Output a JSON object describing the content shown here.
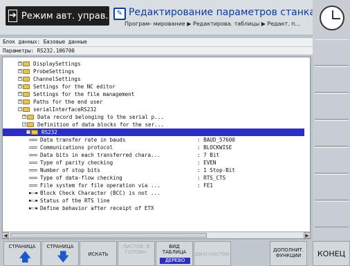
{
  "header": {
    "mode_left": "Режим авт. управ...",
    "mode_right_title": "Редактирование параметров станка",
    "breadcrumb": "Програм- мирование ▶ Редактирова. таблицы ▶ Редакт. п..."
  },
  "info": {
    "block_line": "Блок данных: Базовые данные",
    "param_line": "Параметры: RS232.106700"
  },
  "tree": [
    {
      "label": "DisplaySettings",
      "kind": "folder",
      "expand": "+"
    },
    {
      "label": "ProbeSettings",
      "kind": "folder",
      "expand": "+"
    },
    {
      "label": "ChannelSettings",
      "kind": "folder",
      "expand": "+"
    },
    {
      "label": "Settings for the NC editor",
      "kind": "folder",
      "expand": "+"
    },
    {
      "label": "Settings for the file management",
      "kind": "folder",
      "expand": "+"
    },
    {
      "label": "Paths for the end user",
      "kind": "folder",
      "expand": "+"
    },
    {
      "label": "serialInterfaceRS232",
      "kind": "folder",
      "expand": "−"
    },
    {
      "label": "Data record belonging to the serial p...",
      "kind": "folder",
      "expand": "+"
    },
    {
      "label": "Definition of data blocks for the ser...",
      "kind": "folder",
      "expand": "−"
    },
    {
      "label": "RS232",
      "kind": "folder-open",
      "expand": "−",
      "selected": true
    },
    {
      "label": "Data transfer rate in bauds",
      "kind": "param",
      "value": ": BAUD_57600"
    },
    {
      "label": "Communications protocol",
      "kind": "param",
      "value": ": BLOCKWISE"
    },
    {
      "label": "Data bits in each transferred chara...",
      "kind": "param",
      "value": ": 7 Bit"
    },
    {
      "label": "Type of parity checking",
      "kind": "param",
      "value": ": EVEN"
    },
    {
      "label": "Number of stop bits",
      "kind": "param",
      "value": ": 1 Stop-Bit"
    },
    {
      "label": "Type of data-flow checking",
      "kind": "param",
      "value": ": RTS_CTS"
    },
    {
      "label": "File system for file operation via ...",
      "kind": "param",
      "value": ": FE1"
    },
    {
      "label": "Block Check Character (BCC) is not ...",
      "kind": "param-empty",
      "value": ""
    },
    {
      "label": "Status of the RTS line",
      "kind": "param-empty",
      "value": ""
    },
    {
      "label": "Define behavior after receipt of ETX",
      "kind": "param-empty",
      "value": ""
    }
  ],
  "softkeys": {
    "page_up": "СТРАНИЦА",
    "page_down": "СТРАНИЦА",
    "search": "ИСКАТЬ",
    "sheets_l1": "ЛИСТОВ. В",
    "sheets_l2": "ГОЛОВН.",
    "view_l1": "ВИД",
    "view_l2": "ТАБЛИЦА",
    "view_sub": "ДЕРЕВО",
    "disabled_key": "ДИАГНОСТИК",
    "extra_l1": "ДОПОЛНИТ.",
    "extra_l2": "ФУНКЦИИ",
    "end": "КОНЕЦ"
  },
  "colors": {
    "accent": "#2c2cc7",
    "title_blue": "#0a3b9c",
    "arrow_blue": "#1a59c7"
  }
}
